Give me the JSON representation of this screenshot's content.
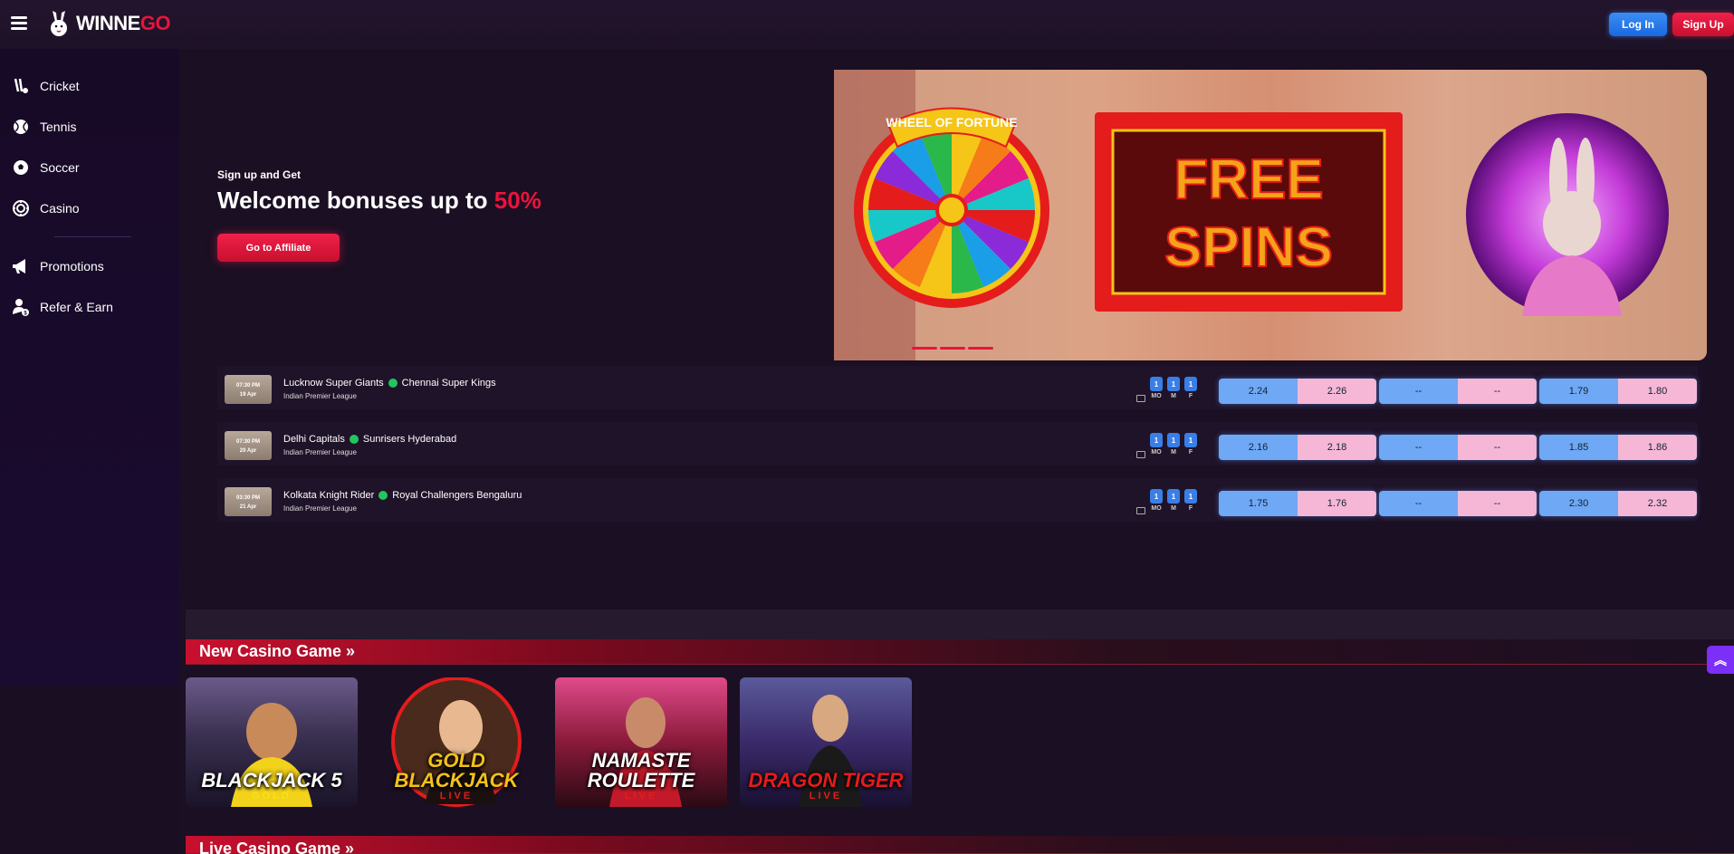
{
  "header": {
    "logo_text_a": "WINNE",
    "logo_text_b": "GO",
    "login_label": "Log In",
    "signup_label": "Sign Up"
  },
  "sidebar": {
    "items": [
      {
        "label": "Cricket",
        "icon": "cricket-icon"
      },
      {
        "label": "Tennis",
        "icon": "tennis-icon"
      },
      {
        "label": "Soccer",
        "icon": "soccer-icon"
      },
      {
        "label": "Casino",
        "icon": "casino-chip-icon"
      },
      {
        "label": "Promotions",
        "icon": "megaphone-icon"
      },
      {
        "label": "Refer & Earn",
        "icon": "refer-icon"
      }
    ]
  },
  "promo": {
    "small": "Sign up and Get",
    "big": "Welcome bonuses up to ",
    "percent": "50%",
    "button": "Go to Affiliate"
  },
  "banner": {
    "wheel_title": "WHEEL OF FORTUNE",
    "sign_text_1": "FREE",
    "sign_text_2": "SPINS"
  },
  "markets": {
    "mo": "MO",
    "m": "M",
    "f": "F",
    "badge": "1"
  },
  "matches": [
    {
      "time": "07:30 PM",
      "date": "19 Apr",
      "team_a": "Lucknow Super Giants",
      "team_b": "Chennai Super Kings",
      "league": "Indian Premier League",
      "odds": [
        "2.24",
        "2.26",
        "--",
        "--",
        "1.79",
        "1.80"
      ]
    },
    {
      "time": "07:30 PM",
      "date": "20 Apr",
      "team_a": "Delhi Capitals",
      "team_b": "Sunrisers Hyderabad",
      "league": "Indian Premier League",
      "odds": [
        "2.16",
        "2.18",
        "--",
        "--",
        "1.85",
        "1.86"
      ]
    },
    {
      "time": "03:30 PM",
      "date": "21 Apr",
      "team_a": "Kolkata Knight Rider",
      "team_b": "Royal Challengers Bengaluru",
      "league": "Indian Premier League",
      "odds": [
        "1.75",
        "1.76",
        "--",
        "--",
        "2.30",
        "2.32"
      ]
    }
  ],
  "sections": {
    "new_casino": "New Casino Game »",
    "live_casino": "Live Casino Game »"
  },
  "games": [
    {
      "title": "BLACKJACK 5",
      "sub": "GOLD"
    },
    {
      "title": "GOLD BLACKJACK",
      "sub": "LIVE"
    },
    {
      "title": "NAMASTE ROULETTE",
      "sub": "LIVE"
    },
    {
      "title": "DRAGON TIGER",
      "sub": "LIVE"
    }
  ],
  "colors": {
    "accent": "#e8143c",
    "login": "#1a68e0",
    "back": "#6fa8f5",
    "lay": "#f6b7d6"
  }
}
